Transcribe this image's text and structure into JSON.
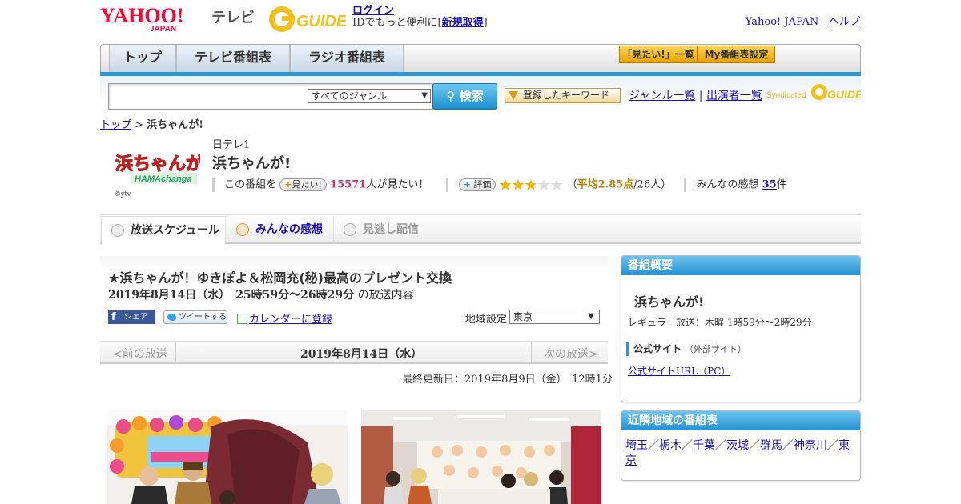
{
  "header": {
    "logo": "YAHOO! JAPAN",
    "logo_main": "YAHOO!",
    "logo_sub": "JAPAN",
    "service": "テレビ",
    "guide_logo": "GUIDE",
    "login": "ログイン",
    "login_note_pre": "IDでもっと便利に[",
    "register": "新規取得",
    "login_note_post": "]",
    "yahoo_japan": "Yahoo! JAPAN",
    "sep": "-",
    "help": "ヘルプ"
  },
  "nav": {
    "tabs": [
      "トップ",
      "テレビ番組表",
      "ラジオ番組表"
    ],
    "mitai_list": "「見たい!」一覧",
    "my_schedule": "My番組表設定"
  },
  "search": {
    "placeholder": "",
    "genre": "すべてのジャンル",
    "button": "検索",
    "keyword_btn": "登録したキーワード",
    "genre_list": "ジャンル一覧",
    "divider": "|",
    "performers": "出演者一覧",
    "syndicated": "Syndicated",
    "syndicated_logo": "GUIDE"
  },
  "breadcrumb": {
    "top": "トップ",
    "sep": ">",
    "current": "浜ちゃんが!"
  },
  "program": {
    "logo_text": "浜ちゃんが!",
    "logo_sub": "HAMAchanga",
    "copyright": "©ytv",
    "channel": "日テレ1",
    "title": "浜ちゃんが!",
    "want_pre": "この番組を",
    "want_btn": "見たい!",
    "want_count": "15571",
    "want_post": "人が見たい！",
    "rate_btn": "評価",
    "rating": 2.85,
    "rating_open": "（",
    "rating_label": "平均2.85点",
    "rating_count": "/26人）",
    "reviews_pre": "みんなの感想",
    "reviews_count": "35",
    "reviews_post": "件"
  },
  "tabs": {
    "schedule": "放送スケジュール",
    "reviews": "みんなの感想",
    "streaming": "見逃し配信"
  },
  "episode": {
    "title": "★浜ちゃんが！ゆきぽよ＆松岡充(秘)最高のプレゼント交換",
    "date": "2019年8月14日（水）　25時59分～26時29分",
    "date_suffix": "の放送内容",
    "share": "シェア",
    "tweet": "ツイートする",
    "calendar": "カレンダーに登録",
    "region_label": "地域設定",
    "region": "東京",
    "prev": "<前の放送",
    "current_date": "2019年8月14日（水）",
    "next": "次の放送>",
    "updated": "最終更新日：2019年8月9日（金）　12時1分"
  },
  "overview": {
    "heading": "番組概要",
    "title": "浜ちゃんが!",
    "regular": "レギュラー放送：木曜 1時59分～2時29分",
    "official": "公式サイト",
    "official_note": "（外部サイト）",
    "official_url": "公式サイトURL（PC）"
  },
  "nearby": {
    "heading": "近隣地域の番組表",
    "regions": [
      "埼玉",
      "栃木",
      "千葉",
      "茨城",
      "群馬",
      "神奈川",
      "東京"
    ],
    "sep": "／"
  },
  "colors": {
    "accent_blue": "#2797d6",
    "pink_count": "#d0306d",
    "rating_orange": "#c77a00",
    "gold_button": "#f5b800"
  }
}
